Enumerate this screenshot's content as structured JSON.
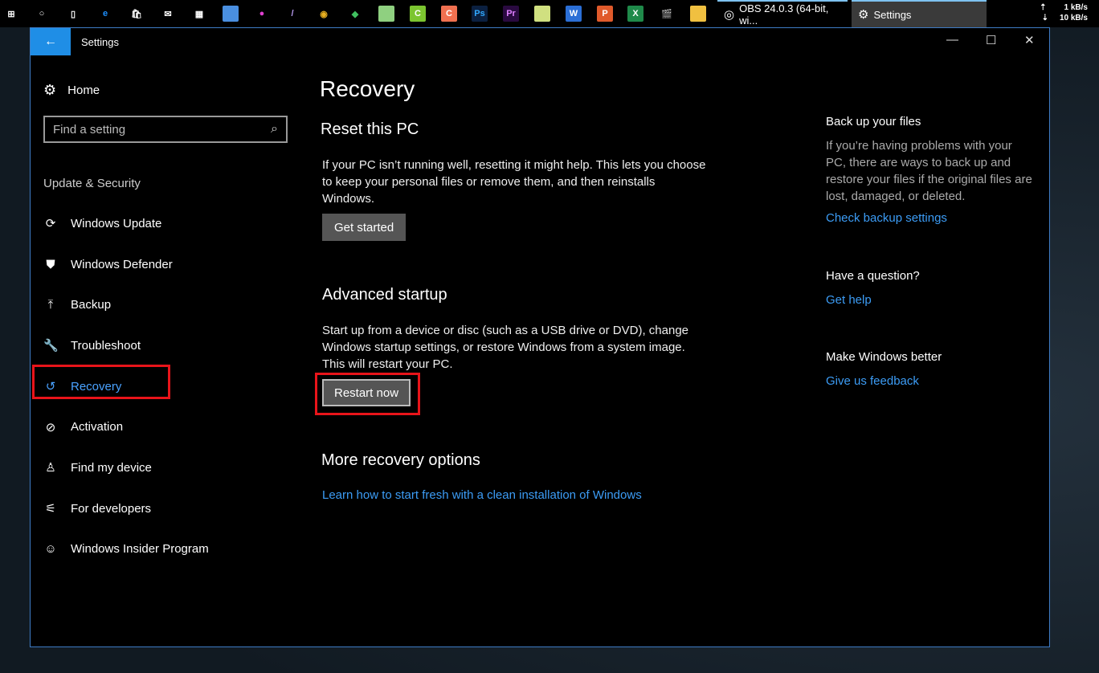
{
  "taskbar": {
    "icons": [
      {
        "name": "start-icon",
        "glyph": "⊞",
        "color": "#fff",
        "bg": "transparent"
      },
      {
        "name": "cortana-icon",
        "glyph": "○",
        "color": "#fff",
        "bg": "transparent"
      },
      {
        "name": "task-view-icon",
        "glyph": "▯",
        "color": "#fff",
        "bg": "transparent"
      },
      {
        "name": "edge-icon",
        "glyph": "e",
        "color": "#1e90ff",
        "bg": "transparent"
      },
      {
        "name": "store-icon",
        "glyph": "🛍",
        "color": "#fff",
        "bg": "transparent"
      },
      {
        "name": "mail-icon",
        "glyph": "✉",
        "color": "#fff",
        "bg": "transparent"
      },
      {
        "name": "calculator-icon",
        "glyph": "▦",
        "color": "#fff",
        "bg": "transparent"
      },
      {
        "name": "app-icon",
        "glyph": "",
        "color": "#fff",
        "bg": "#4a8fe0"
      },
      {
        "name": "paint-icon",
        "glyph": "●",
        "color": "#e040d0",
        "bg": "transparent"
      },
      {
        "name": "feather-icon",
        "glyph": "/",
        "color": "#b89cf0",
        "bg": "transparent"
      },
      {
        "name": "chrome-icon",
        "glyph": "◉",
        "color": "#e8b020",
        "bg": "transparent"
      },
      {
        "name": "network-app-icon",
        "glyph": "◆",
        "color": "#40c060",
        "bg": "transparent"
      },
      {
        "name": "drive-icon",
        "glyph": "",
        "color": "#fff",
        "bg": "#8fd080"
      },
      {
        "name": "camtasia-icon",
        "glyph": "C",
        "color": "#fff",
        "bg": "#7cc530"
      },
      {
        "name": "camtasia-recorder-icon",
        "glyph": "C",
        "color": "#fff",
        "bg": "#f07050"
      },
      {
        "name": "photoshop-icon",
        "glyph": "Ps",
        "color": "#31a8ff",
        "bg": "#0b2040"
      },
      {
        "name": "premiere-icon",
        "glyph": "Pr",
        "color": "#e080ff",
        "bg": "#2a0a40"
      },
      {
        "name": "notes-icon",
        "glyph": "",
        "color": "#fff",
        "bg": "#d0e080"
      },
      {
        "name": "word-icon",
        "glyph": "W",
        "color": "#fff",
        "bg": "#2b6fd6"
      },
      {
        "name": "powerpoint-icon",
        "glyph": "P",
        "color": "#fff",
        "bg": "#e05a2b"
      },
      {
        "name": "excel-icon",
        "glyph": "X",
        "color": "#fff",
        "bg": "#1f8a4a"
      },
      {
        "name": "movie-maker-icon",
        "glyph": "🎬",
        "color": "#fff",
        "bg": "transparent"
      },
      {
        "name": "file-explorer-icon",
        "glyph": "",
        "color": "#fff",
        "bg": "#f0c040"
      }
    ],
    "obs_label": "OBS 24.0.3 (64-bit, wi...",
    "settings_label": "Settings",
    "upload": "1 kB/s",
    "download": "10 kB/s"
  },
  "window": {
    "title": "Settings",
    "back": "←",
    "minimize": "—",
    "maximize": "☐",
    "close": "✕"
  },
  "sidebar": {
    "home": "Home",
    "search_placeholder": "Find a setting",
    "section": "Update & Security",
    "items": [
      {
        "label": "Windows Update",
        "icon": "⟳",
        "name": "windows-update"
      },
      {
        "label": "Windows Defender",
        "icon": "⛊",
        "name": "windows-defender"
      },
      {
        "label": "Backup",
        "icon": "⤒",
        "name": "backup"
      },
      {
        "label": "Troubleshoot",
        "icon": "🔧",
        "name": "troubleshoot"
      },
      {
        "label": "Recovery",
        "icon": "↺",
        "name": "recovery"
      },
      {
        "label": "Activation",
        "icon": "⊘",
        "name": "activation"
      },
      {
        "label": "Find my device",
        "icon": "♙",
        "name": "find-my-device"
      },
      {
        "label": "For developers",
        "icon": "⚟",
        "name": "for-developers"
      },
      {
        "label": "Windows Insider Program",
        "icon": "☺",
        "name": "windows-insider-program"
      }
    ],
    "active": "Recovery"
  },
  "main": {
    "title": "Recovery",
    "reset": {
      "heading": "Reset this PC",
      "text": "If your PC isn’t running well, resetting it might help. This lets you choose to keep your personal files or remove them, and then reinstalls Windows.",
      "button": "Get started"
    },
    "advanced": {
      "heading": "Advanced startup",
      "text": "Start up from a device or disc (such as a USB drive or DVD), change Windows startup settings, or restore Windows from a system image. This will restart your PC.",
      "button": "Restart now"
    },
    "more": {
      "heading": "More recovery options",
      "link": "Learn how to start fresh with a clean installation of Windows"
    }
  },
  "right": {
    "backup": {
      "heading": "Back up your files",
      "text": "If you’re having problems with your PC, there are ways to back up and restore your files if the original files are lost, damaged, or deleted.",
      "link": "Check backup settings"
    },
    "question": {
      "heading": "Have a question?",
      "link": "Get help"
    },
    "better": {
      "heading": "Make Windows better",
      "link": "Give us feedback"
    }
  },
  "colors": {
    "accent": "#1f8ee6",
    "link": "#3c9cf5",
    "highlight": "#e8141a"
  }
}
